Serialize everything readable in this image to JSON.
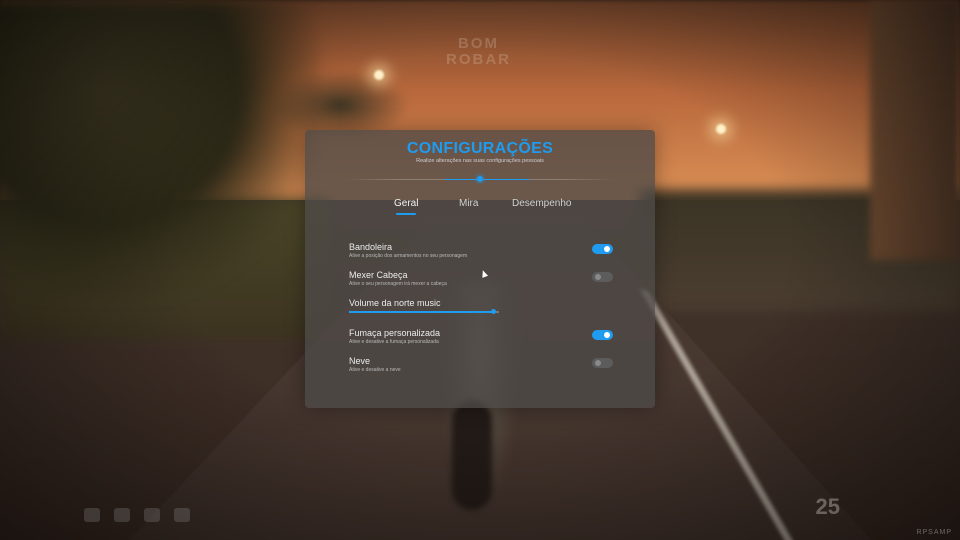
{
  "watermark": {
    "line1": "BOM",
    "line2": "ROBAR"
  },
  "panel": {
    "title": "CONFIGURAÇÕES",
    "subtitle": "Realize alterações nas suas configurações pessoais"
  },
  "tabs": [
    {
      "label": "Geral",
      "active": true
    },
    {
      "label": "Mira",
      "active": false
    },
    {
      "label": "Desempenho",
      "active": false
    }
  ],
  "settings": [
    {
      "label": "Bandoleira",
      "desc": "Ative a posição dos armamentos no seu personagem",
      "type": "toggle",
      "on": true
    },
    {
      "label": "Mexer Cabeça",
      "desc": "Ative o seu personagem irá mexer a cabeça",
      "type": "toggle",
      "on": false
    },
    {
      "label": "Volume da norte music",
      "type": "slider",
      "value": 0.96
    },
    {
      "label": "Fumaça personalizada",
      "desc": "Ative e desative a fumaça personalizada",
      "type": "toggle",
      "on": true
    },
    {
      "label": "Neve",
      "desc": "Ative e desative a neve",
      "type": "toggle",
      "on": false
    }
  ],
  "hud": {
    "speed": "25",
    "version": "RPSAMP"
  },
  "colors": {
    "accent": "#1f9bef",
    "panel_bg": "rgba(78,74,72,.78)"
  }
}
